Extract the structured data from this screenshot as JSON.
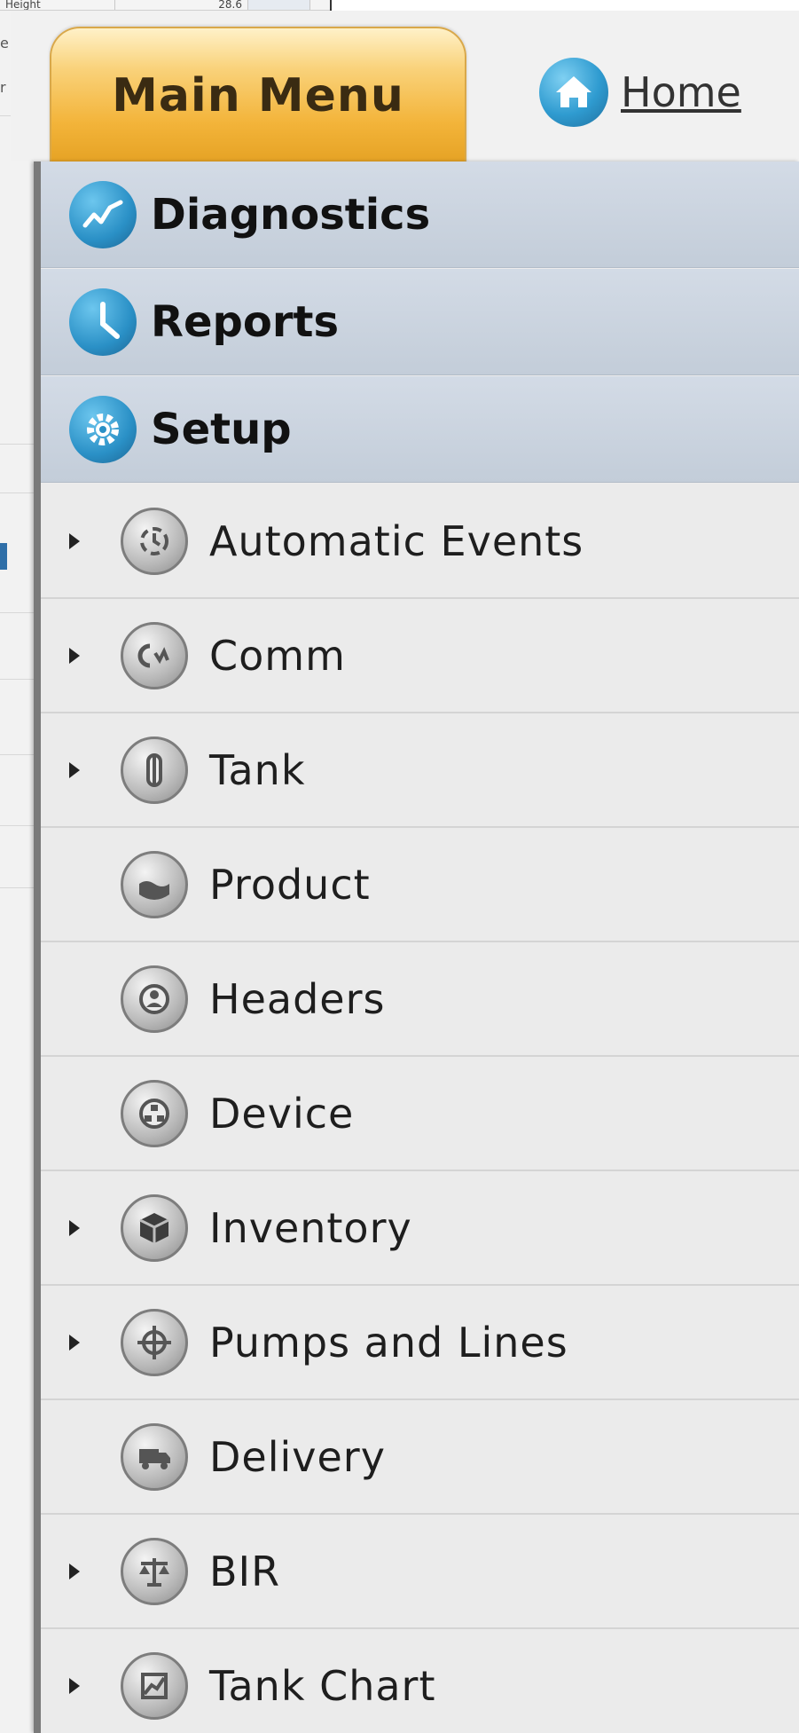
{
  "background_window": {
    "top_cell_1": "Height",
    "top_cell_2": "28.6",
    "side_text": [
      "e",
      "r"
    ]
  },
  "header": {
    "main_menu_label": "Main Menu",
    "home_label": "Home"
  },
  "menu": {
    "top_items": [
      {
        "label": "Diagnostics",
        "icon": "diagnostics-icon"
      },
      {
        "label": "Reports",
        "icon": "clock-icon"
      },
      {
        "label": "Setup",
        "icon": "gear-icon"
      }
    ],
    "setup_items": [
      {
        "label": "Automatic Events",
        "icon": "automatic-events-icon",
        "expandable": true
      },
      {
        "label": "Comm",
        "icon": "comm-icon",
        "expandable": true
      },
      {
        "label": "Tank",
        "icon": "tank-icon",
        "expandable": true
      },
      {
        "label": "Product",
        "icon": "product-icon",
        "expandable": false
      },
      {
        "label": "Headers",
        "icon": "headers-icon",
        "expandable": false
      },
      {
        "label": "Device",
        "icon": "device-icon",
        "expandable": false
      },
      {
        "label": "Inventory",
        "icon": "inventory-icon",
        "expandable": true
      },
      {
        "label": "Pumps and Lines",
        "icon": "pumps-and-lines-icon",
        "expandable": true
      },
      {
        "label": "Delivery",
        "icon": "delivery-icon",
        "expandable": false
      },
      {
        "label": "BIR",
        "icon": "bir-icon",
        "expandable": true
      },
      {
        "label": "Tank Chart",
        "icon": "tank-chart-icon",
        "expandable": true
      }
    ]
  },
  "colors": {
    "tab_gold": "#f3b43a",
    "icon_blue": "#2a90c6",
    "top_item_bg": "#c8d1dd",
    "sub_item_bg": "#ebebeb"
  }
}
